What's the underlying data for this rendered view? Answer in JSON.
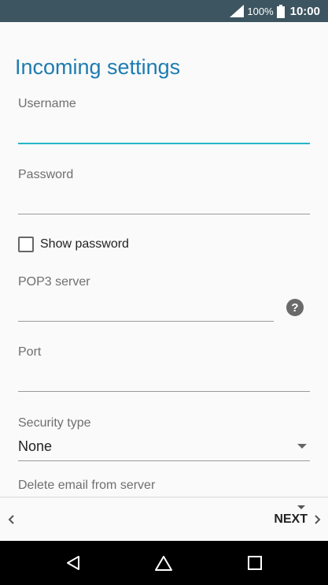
{
  "status_bar": {
    "battery": "100%",
    "time": "10:00"
  },
  "page": {
    "title": "Incoming settings"
  },
  "form": {
    "username": {
      "label": "Username",
      "value": ""
    },
    "password": {
      "label": "Password",
      "value": ""
    },
    "show_password": {
      "label": "Show password",
      "checked": false
    },
    "server": {
      "label": "POP3 server",
      "value": ""
    },
    "port": {
      "label": "Port",
      "value": ""
    },
    "security_type": {
      "label": "Security type",
      "value": "None"
    },
    "delete_email": {
      "label": "Delete email from server"
    }
  },
  "bottom_bar": {
    "next_label": "NEXT"
  },
  "colors": {
    "status_bar": "#3d5561",
    "title": "#1d7cb1",
    "active_underline": "#26b6c7"
  },
  "icons": [
    "signal-icon",
    "battery-icon",
    "help-icon",
    "chevron-left-icon",
    "chevron-right-icon",
    "back-nav-icon",
    "home-nav-icon",
    "recents-nav-icon"
  ]
}
